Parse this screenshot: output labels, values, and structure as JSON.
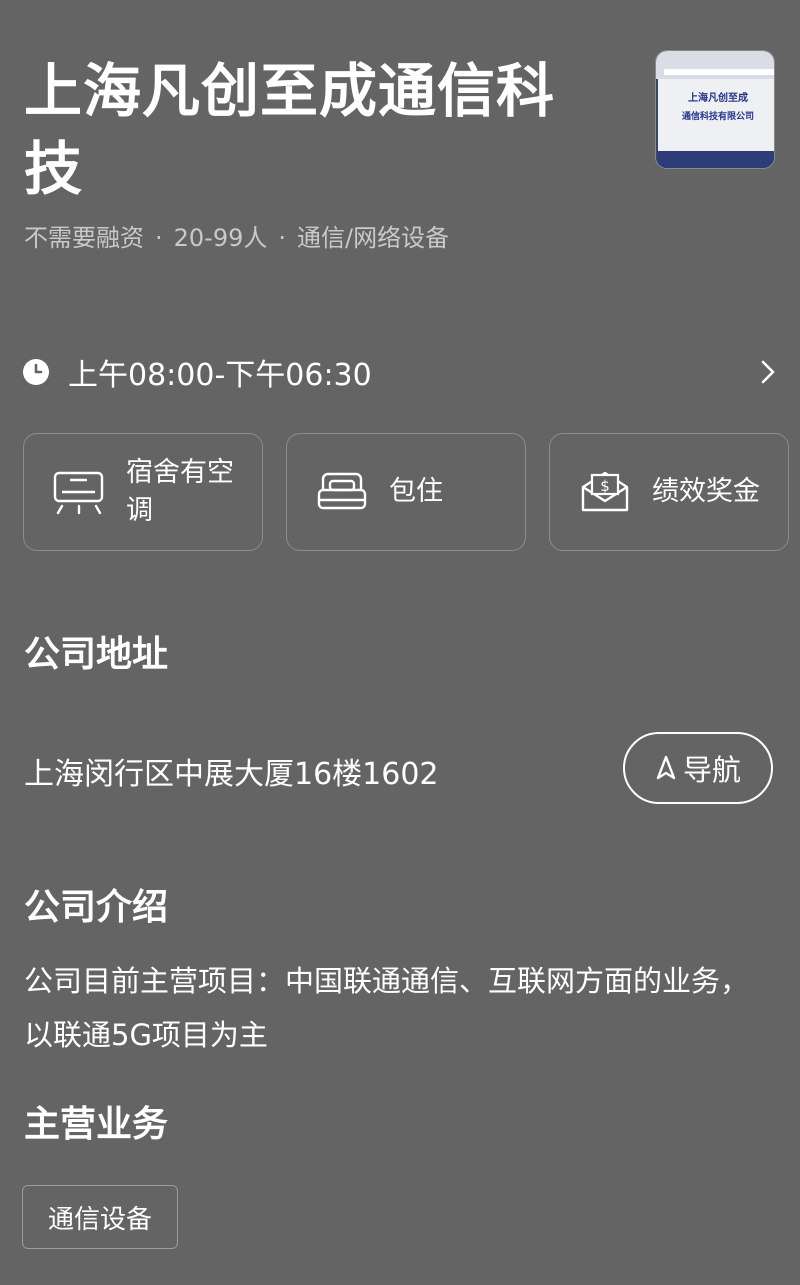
{
  "company": {
    "name": "上海凡创至成通信科技",
    "logo_text_line1": "上海凡创至成",
    "logo_text_line2": "通信科技有限公司",
    "meta": [
      "不需要融资",
      "20-99人",
      "通信/网络设备"
    ]
  },
  "hours": {
    "text": "上午08:00-下午06:30"
  },
  "benefits": [
    {
      "label": "宿舍有空调",
      "icon": "air-conditioner-icon"
    },
    {
      "label": "包住",
      "icon": "bed-icon"
    },
    {
      "label": "绩效奖金",
      "icon": "bonus-envelope-icon"
    }
  ],
  "address_section": {
    "title": "公司地址",
    "address": "上海闵行区中展大厦16楼1602",
    "nav_label": "导航"
  },
  "intro_section": {
    "title": "公司介绍",
    "text": "公司目前主营项目：中国联通通信、互联网方面的业务，以联通5G项目为主"
  },
  "business_section": {
    "title": "主营业务",
    "tags": [
      "通信设备"
    ]
  },
  "colors": {
    "background": "#646464",
    "text": "#ffffff",
    "muted": "#c9c9c9",
    "border": "#8c8c8c"
  }
}
